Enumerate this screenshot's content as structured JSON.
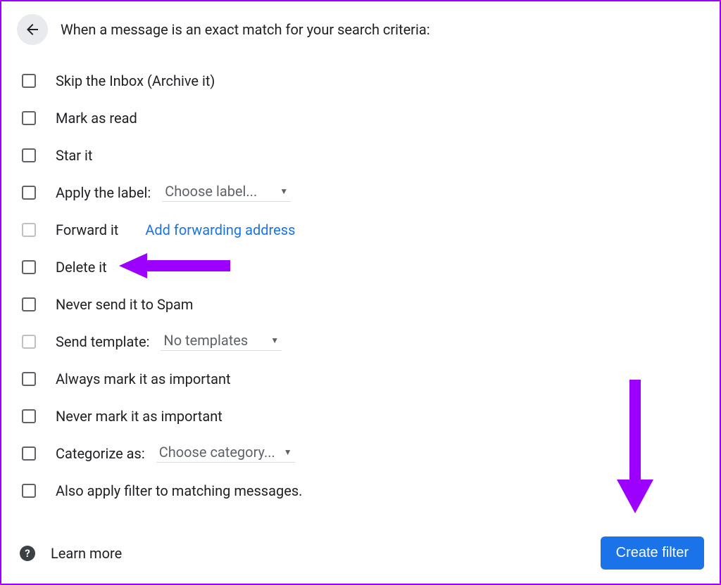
{
  "header": {
    "title": "When a message is an exact match for your search criteria:"
  },
  "options": {
    "skip_inbox": "Skip the Inbox (Archive it)",
    "mark_read": "Mark as read",
    "star_it": "Star it",
    "apply_label": "Apply the label:",
    "apply_label_value": "Choose label...",
    "forward_it": "Forward it",
    "forward_link": "Add forwarding address",
    "delete_it": "Delete it",
    "never_spam": "Never send it to Spam",
    "send_template": "Send template:",
    "send_template_value": "No templates",
    "always_important": "Always mark it as important",
    "never_important": "Never mark it as important",
    "categorize_as": "Categorize as:",
    "categorize_value": "Choose category...",
    "also_apply": "Also apply filter to matching messages."
  },
  "footer": {
    "learn_more": "Learn more",
    "create_button": "Create filter"
  },
  "colors": {
    "accent": "#1a73e8",
    "annotation": "#9c00ff"
  }
}
